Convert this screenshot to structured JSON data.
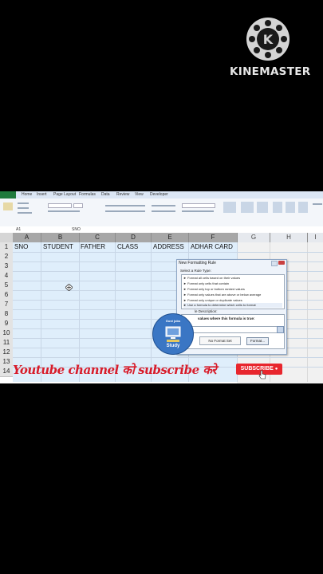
{
  "watermark": {
    "brand": "KINEMASTER",
    "logo_letter": "K"
  },
  "excel": {
    "tabs": [
      "Home",
      "Insert",
      "Page Layout",
      "Formulas",
      "Data",
      "Review",
      "View",
      "Developer"
    ],
    "name_box": "A1",
    "formula_value": "SNO",
    "columns": [
      "A",
      "B",
      "C",
      "D",
      "E",
      "F",
      "G",
      "H",
      "I"
    ],
    "rows": [
      "1",
      "2",
      "3",
      "4",
      "5",
      "6",
      "7",
      "8",
      "9",
      "10",
      "11",
      "12",
      "13",
      "14"
    ],
    "headers": [
      "SNO",
      "STUDENT",
      "FATHER",
      "CLASS",
      "ADDRESS",
      "ADHAR CARD"
    ]
  },
  "dialog": {
    "title": "New Formatting Rule",
    "select_rule_type_label": "Select a Rule Type:",
    "rule_types": [
      "► Format all cells based on their values",
      "► Format only cells that contain",
      "► Format only top or bottom ranked values",
      "► Format only values that are above or below average",
      "► Format only unique or duplicate values",
      "► Use a formula to determine which cells to format"
    ],
    "description_label": "le Description:",
    "formula_label": "values where this formula is true:",
    "preview_label": "No Format Set",
    "format_button": "Format..."
  },
  "overlay": {
    "banner_text": "Youtube channel को subscribe  करे",
    "subscribe_button": "SUBSCRIBE",
    "channel_logo_top": "Govt jobs",
    "channel_logo_bottom": "Study"
  },
  "colors": {
    "subscribe_red": "#e8262d",
    "banner_red": "#d81c2a",
    "selection_blue": "#dfeefb"
  }
}
